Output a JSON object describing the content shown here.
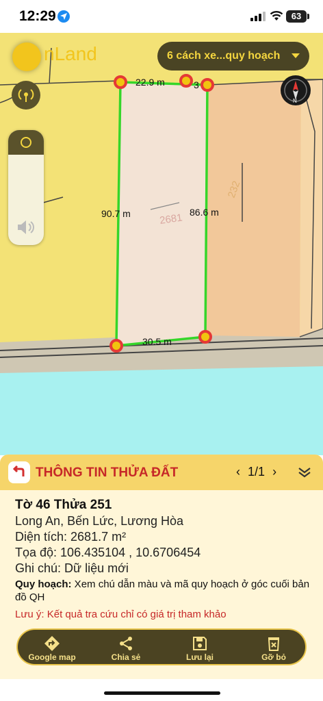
{
  "status": {
    "time": "12:29",
    "battery": "63"
  },
  "map": {
    "logo": "nLand",
    "plan_select": "6 cách xe...quy hoạch",
    "segments": {
      "top": "22.9 m",
      "left": "90.7 m",
      "right": "86.6 m",
      "bottom": "30.5 m",
      "top_extra": "3"
    },
    "parcel_no": "2681",
    "neighbor_no": "232",
    "colors": {
      "road_water": "#a8f1f0",
      "residential": "#f3e276",
      "selected": "#f3e3d5",
      "boundary": "#35d62a"
    }
  },
  "panel": {
    "title": "THÔNG TIN THỬA ĐẤT",
    "pager": "1/1",
    "heading": "Tờ 46 Thửa 251",
    "address": "Long An, Bến Lức, Lương Hòa",
    "area": "Diện tích: 2681.7 m²",
    "coords": "Tọa độ: 106.435104 , 10.6706454",
    "note": "Ghi chú: Dữ liệu mới",
    "plan_label": "Quy hoạch:",
    "plan_text": " Xem chú dẫn màu và mã quy hoạch ở góc cuối bản đồ QH",
    "warning": "Lưu ý: Kết quả tra cứu chỉ có giá trị tham khảo"
  },
  "actions": [
    {
      "label": "Google map",
      "icon": "directions-icon"
    },
    {
      "label": "Chia sẻ",
      "icon": "share-icon"
    },
    {
      "label": "Lưu lại",
      "icon": "save-icon"
    },
    {
      "label": "Gỡ bỏ",
      "icon": "delete-icon"
    }
  ]
}
